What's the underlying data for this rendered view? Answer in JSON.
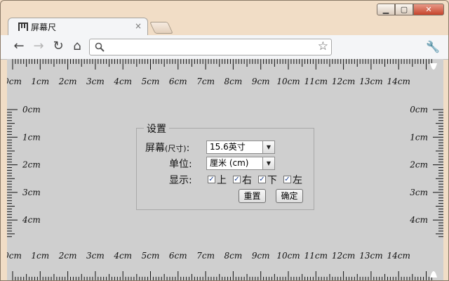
{
  "window": {
    "minimize_glyph": "▁",
    "maximize_glyph": "▢",
    "close_glyph": "✕"
  },
  "tab": {
    "title": "屏幕尺",
    "close_glyph": "×"
  },
  "toolbar": {
    "back_glyph": "←",
    "forward_glyph": "→",
    "reload_glyph": "↻",
    "home_glyph": "⌂",
    "star_glyph": "☆",
    "wrench_glyph": "🔧",
    "search_icon": "search-icon"
  },
  "ruler": {
    "unit": "cm",
    "top_labels": [
      "0cm",
      "1cm",
      "2cm",
      "3cm",
      "4cm",
      "5cm",
      "6cm",
      "7cm",
      "8cm",
      "9cm",
      "10cm",
      "11cm",
      "12cm",
      "13cm",
      "14cm"
    ],
    "bottom_labels": [
      "0cm",
      "1cm",
      "2cm",
      "3cm",
      "4cm",
      "5cm",
      "6cm",
      "7cm",
      "8cm",
      "9cm",
      "10cm",
      "11cm",
      "12cm",
      "13cm",
      "14cm"
    ],
    "left_labels": [
      "0cm",
      "1cm",
      "2cm",
      "3cm",
      "4cm"
    ],
    "right_labels": [
      "0cm",
      "1cm",
      "2cm",
      "3cm",
      "4cm"
    ]
  },
  "settings": {
    "legend": "设置",
    "screen_label": "屏幕",
    "screen_label_small": "(尺寸)",
    "screen_label_colon": ":",
    "screen_value": "15.6英寸",
    "unit_label": "单位:",
    "unit_value": "厘米 (cm)",
    "display_label": "显示:",
    "top": "上",
    "right": "右",
    "bottom": "下",
    "left": "左",
    "reset_button": "重置",
    "ok_button": "确定"
  }
}
